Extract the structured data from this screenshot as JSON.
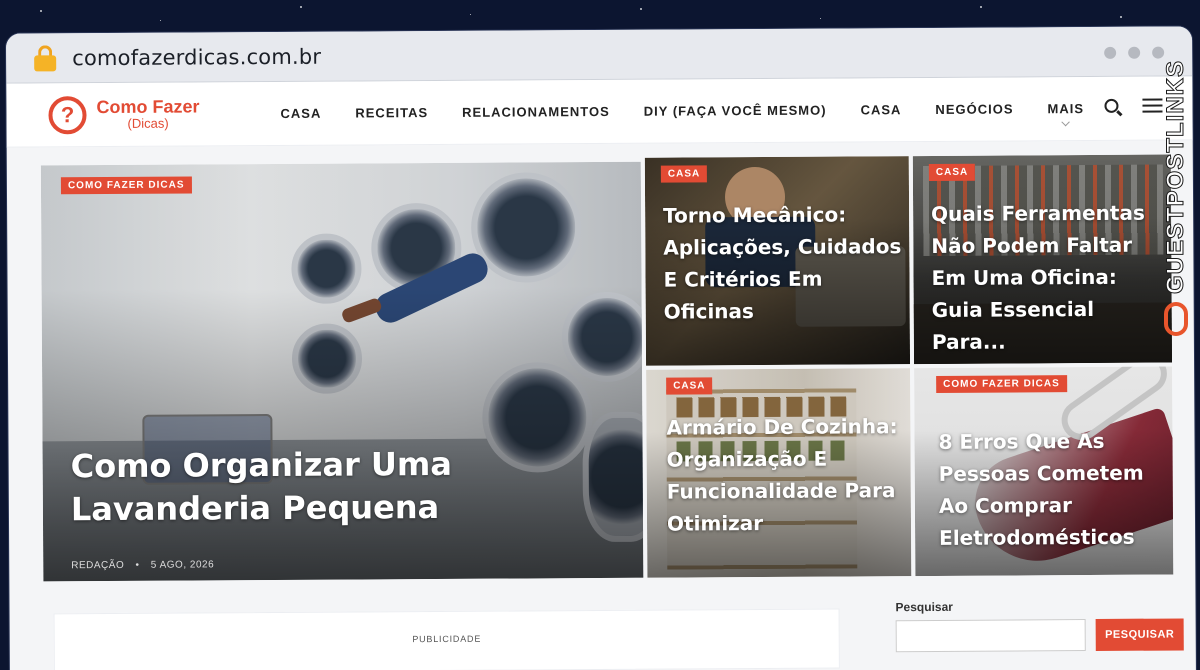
{
  "browser": {
    "url": "comofazerdicas.com.br"
  },
  "site": {
    "logo_symbol": "?",
    "logo_title": "Como Fazer",
    "logo_sub": "(Dicas)",
    "nav": [
      "CASA",
      "RECEITAS",
      "RELACIONAMENTOS",
      "DIY (FAÇA VOCÊ MESMO)",
      "CASA",
      "NEGÓCIOS",
      "MAIS"
    ]
  },
  "hero": {
    "main": {
      "tag": "COMO FAZER DICAS",
      "title": "Como Organizar Uma Lavanderia Pequena",
      "author": "REDAÇÃO",
      "date": "5 AGO, 2026"
    },
    "cards": [
      {
        "tag": "CASA",
        "title": "Torno Mecânico: Aplicações, Cuidados E Critérios Em Oficinas"
      },
      {
        "tag": "CASA",
        "title": "Quais Ferramentas Não Podem Faltar Em Uma Oficina: Guia Essencial Para..."
      },
      {
        "tag": "CASA",
        "title": "Armário De Cozinha: Organização E Funcionalidade Para Otimizar"
      },
      {
        "tag": "COMO FAZER DICAS",
        "title": "8 Erros Que As Pessoas Cometem Ao Comprar Eletrodomésticos"
      }
    ]
  },
  "ads": {
    "label": "PUBLICIDADE"
  },
  "sidebar": {
    "search_label": "Pesquisar",
    "search_button": "PESQUISAR"
  },
  "watermark": {
    "text": "GUESTPOSTLINKS"
  },
  "colors": {
    "accent": "#e24b34",
    "background": "#0c1530"
  }
}
